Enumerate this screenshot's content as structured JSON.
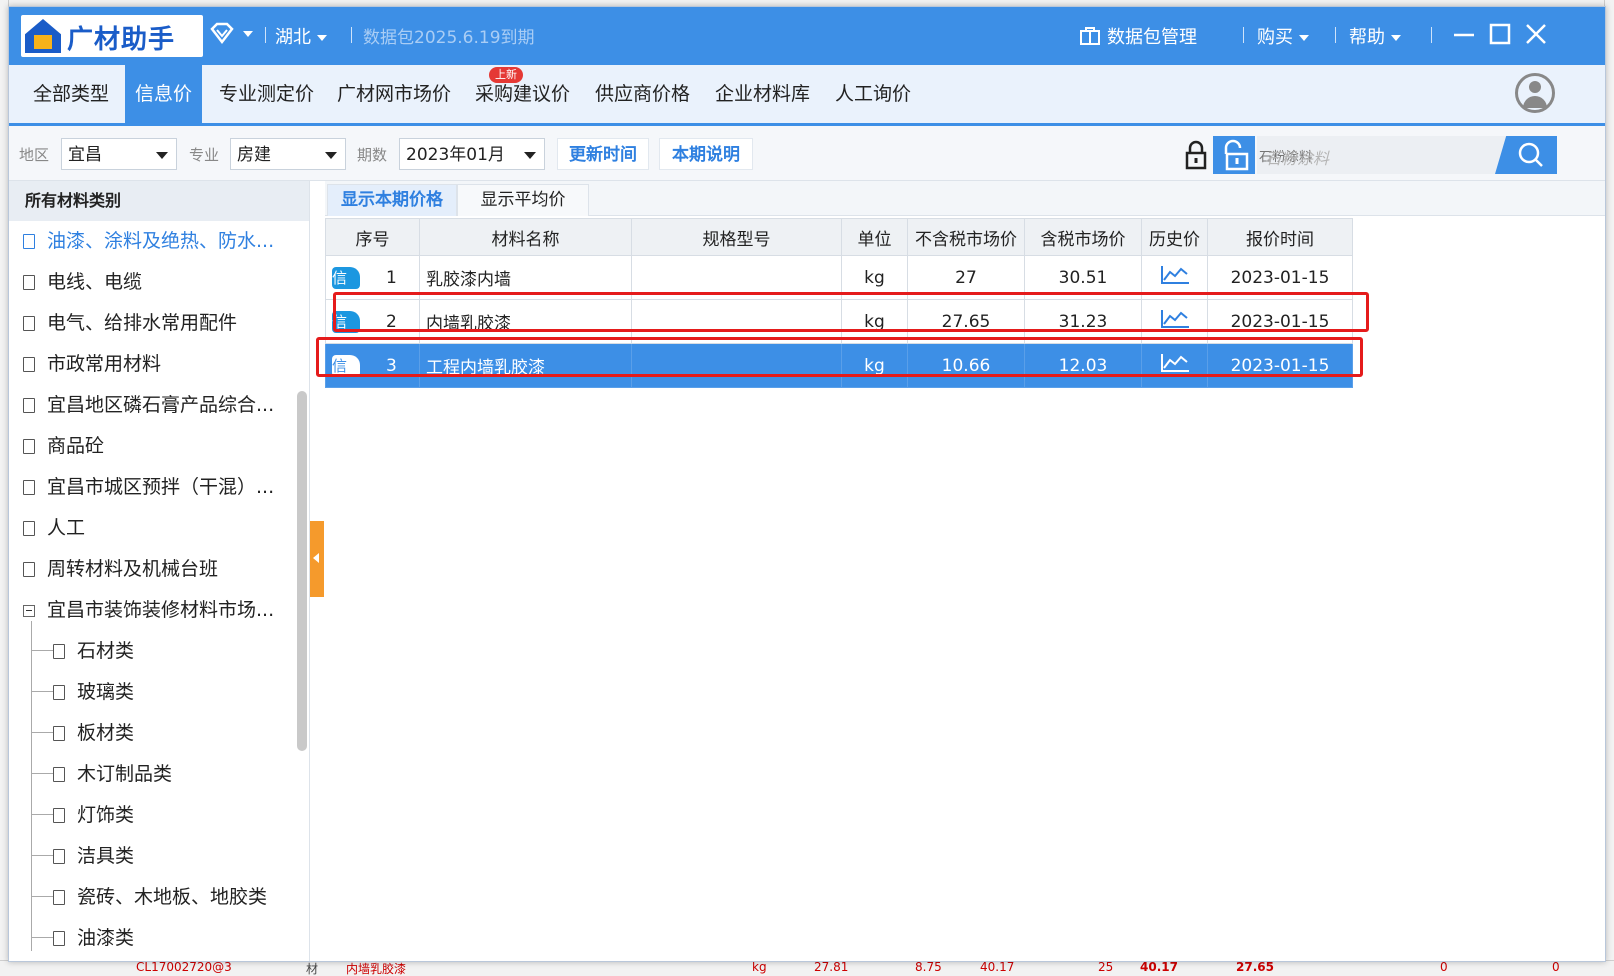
{
  "app": {
    "title": "广材助手",
    "region": "湖北",
    "expiry": "数据包2025.6.19到期",
    "package_manage": "数据包管理",
    "buy": "购买",
    "help": "帮助"
  },
  "menu": {
    "items": [
      "全部类型",
      "信息价",
      "专业测定价",
      "广材网市场价",
      "采购建议价",
      "供应商价格",
      "企业材料库",
      "人工询价"
    ],
    "active": "信息价",
    "new_badge": "上新"
  },
  "filters": {
    "area_label": "地区",
    "area_value": "宜昌",
    "major_label": "专业",
    "major_value": "房建",
    "period_label": "期数",
    "period_value": "2023年01月",
    "update_time_btn": "更新时间",
    "period_note_btn": "本期说明",
    "search_placeholder": "石粉涂料"
  },
  "sidebar": {
    "header": "所有材料类别",
    "items": [
      "油漆、涂料及绝热、防水...",
      "电线、电缆",
      "电气、给排水常用配件",
      "市政常用材料",
      "宜昌地区磷石膏产品综合...",
      "商品砼",
      "宜昌市城区预拌（干混）...",
      "人工",
      "周转材料及机械台班",
      "宜昌市装饰装修材料市场..."
    ],
    "children": [
      "石材类",
      "玻璃类",
      "板材类",
      "木订制品类",
      "灯饰类",
      "洁具类",
      "瓷砖、木地板、地胶类",
      "油漆类"
    ]
  },
  "tabs": {
    "current": "显示本期价格",
    "average": "显示平均价"
  },
  "table": {
    "headers": [
      "序号",
      "材料名称",
      "规格型号",
      "单位",
      "不含税市场价",
      "含税市场价",
      "历史价",
      "报价时间"
    ],
    "tag": "信",
    "rows": [
      {
        "no": "1",
        "name": "乳胶漆内墙",
        "spec": "",
        "unit": "kg",
        "price_ex_tax": "27",
        "price_inc_tax": "30.51",
        "date": "2023-01-15"
      },
      {
        "no": "2",
        "name": "内墙乳胶漆",
        "spec": "",
        "unit": "kg",
        "price_ex_tax": "27.65",
        "price_inc_tax": "31.23",
        "date": "2023-01-15"
      },
      {
        "no": "3",
        "name": "工程内墙乳胶漆",
        "spec": "",
        "unit": "kg",
        "price_ex_tax": "10.66",
        "price_inc_tax": "12.03",
        "date": "2023-01-15"
      }
    ]
  },
  "background_row": {
    "code": "CL17002720@3",
    "type": "材",
    "name": "内墙乳胶漆",
    "unit": "kg",
    "v1": "27.81",
    "v2": "8.75",
    "v3": "40.17",
    "v4": "25",
    "v5": "40.17",
    "v6": "27.65",
    "v7": "0",
    "v8": "0"
  },
  "colors": {
    "brand": "#3d8fe6",
    "highlight": "#e51b1b",
    "accent_orange": "#f59a2c"
  }
}
